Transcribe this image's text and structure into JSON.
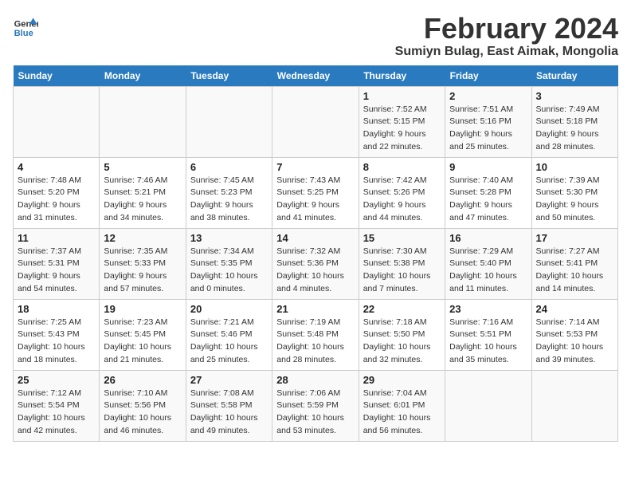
{
  "header": {
    "logo_line1": "General",
    "logo_line2": "Blue",
    "main_title": "February 2024",
    "subtitle": "Sumiyn Bulag, East Aimak, Mongolia"
  },
  "days_of_week": [
    "Sunday",
    "Monday",
    "Tuesday",
    "Wednesday",
    "Thursday",
    "Friday",
    "Saturday"
  ],
  "weeks": [
    [
      {
        "day": "",
        "sunrise": "",
        "sunset": "",
        "daylight": ""
      },
      {
        "day": "",
        "sunrise": "",
        "sunset": "",
        "daylight": ""
      },
      {
        "day": "",
        "sunrise": "",
        "sunset": "",
        "daylight": ""
      },
      {
        "day": "",
        "sunrise": "",
        "sunset": "",
        "daylight": ""
      },
      {
        "day": "1",
        "sunrise": "7:52 AM",
        "sunset": "5:15 PM",
        "daylight": "9 hours and 22 minutes."
      },
      {
        "day": "2",
        "sunrise": "7:51 AM",
        "sunset": "5:16 PM",
        "daylight": "9 hours and 25 minutes."
      },
      {
        "day": "3",
        "sunrise": "7:49 AM",
        "sunset": "5:18 PM",
        "daylight": "9 hours and 28 minutes."
      }
    ],
    [
      {
        "day": "4",
        "sunrise": "7:48 AM",
        "sunset": "5:20 PM",
        "daylight": "9 hours and 31 minutes."
      },
      {
        "day": "5",
        "sunrise": "7:46 AM",
        "sunset": "5:21 PM",
        "daylight": "9 hours and 34 minutes."
      },
      {
        "day": "6",
        "sunrise": "7:45 AM",
        "sunset": "5:23 PM",
        "daylight": "9 hours and 38 minutes."
      },
      {
        "day": "7",
        "sunrise": "7:43 AM",
        "sunset": "5:25 PM",
        "daylight": "9 hours and 41 minutes."
      },
      {
        "day": "8",
        "sunrise": "7:42 AM",
        "sunset": "5:26 PM",
        "daylight": "9 hours and 44 minutes."
      },
      {
        "day": "9",
        "sunrise": "7:40 AM",
        "sunset": "5:28 PM",
        "daylight": "9 hours and 47 minutes."
      },
      {
        "day": "10",
        "sunrise": "7:39 AM",
        "sunset": "5:30 PM",
        "daylight": "9 hours and 50 minutes."
      }
    ],
    [
      {
        "day": "11",
        "sunrise": "7:37 AM",
        "sunset": "5:31 PM",
        "daylight": "9 hours and 54 minutes."
      },
      {
        "day": "12",
        "sunrise": "7:35 AM",
        "sunset": "5:33 PM",
        "daylight": "9 hours and 57 minutes."
      },
      {
        "day": "13",
        "sunrise": "7:34 AM",
        "sunset": "5:35 PM",
        "daylight": "10 hours and 0 minutes."
      },
      {
        "day": "14",
        "sunrise": "7:32 AM",
        "sunset": "5:36 PM",
        "daylight": "10 hours and 4 minutes."
      },
      {
        "day": "15",
        "sunrise": "7:30 AM",
        "sunset": "5:38 PM",
        "daylight": "10 hours and 7 minutes."
      },
      {
        "day": "16",
        "sunrise": "7:29 AM",
        "sunset": "5:40 PM",
        "daylight": "10 hours and 11 minutes."
      },
      {
        "day": "17",
        "sunrise": "7:27 AM",
        "sunset": "5:41 PM",
        "daylight": "10 hours and 14 minutes."
      }
    ],
    [
      {
        "day": "18",
        "sunrise": "7:25 AM",
        "sunset": "5:43 PM",
        "daylight": "10 hours and 18 minutes."
      },
      {
        "day": "19",
        "sunrise": "7:23 AM",
        "sunset": "5:45 PM",
        "daylight": "10 hours and 21 minutes."
      },
      {
        "day": "20",
        "sunrise": "7:21 AM",
        "sunset": "5:46 PM",
        "daylight": "10 hours and 25 minutes."
      },
      {
        "day": "21",
        "sunrise": "7:19 AM",
        "sunset": "5:48 PM",
        "daylight": "10 hours and 28 minutes."
      },
      {
        "day": "22",
        "sunrise": "7:18 AM",
        "sunset": "5:50 PM",
        "daylight": "10 hours and 32 minutes."
      },
      {
        "day": "23",
        "sunrise": "7:16 AM",
        "sunset": "5:51 PM",
        "daylight": "10 hours and 35 minutes."
      },
      {
        "day": "24",
        "sunrise": "7:14 AM",
        "sunset": "5:53 PM",
        "daylight": "10 hours and 39 minutes."
      }
    ],
    [
      {
        "day": "25",
        "sunrise": "7:12 AM",
        "sunset": "5:54 PM",
        "daylight": "10 hours and 42 minutes."
      },
      {
        "day": "26",
        "sunrise": "7:10 AM",
        "sunset": "5:56 PM",
        "daylight": "10 hours and 46 minutes."
      },
      {
        "day": "27",
        "sunrise": "7:08 AM",
        "sunset": "5:58 PM",
        "daylight": "10 hours and 49 minutes."
      },
      {
        "day": "28",
        "sunrise": "7:06 AM",
        "sunset": "5:59 PM",
        "daylight": "10 hours and 53 minutes."
      },
      {
        "day": "29",
        "sunrise": "7:04 AM",
        "sunset": "6:01 PM",
        "daylight": "10 hours and 56 minutes."
      },
      {
        "day": "",
        "sunrise": "",
        "sunset": "",
        "daylight": ""
      },
      {
        "day": "",
        "sunrise": "",
        "sunset": "",
        "daylight": ""
      }
    ]
  ]
}
